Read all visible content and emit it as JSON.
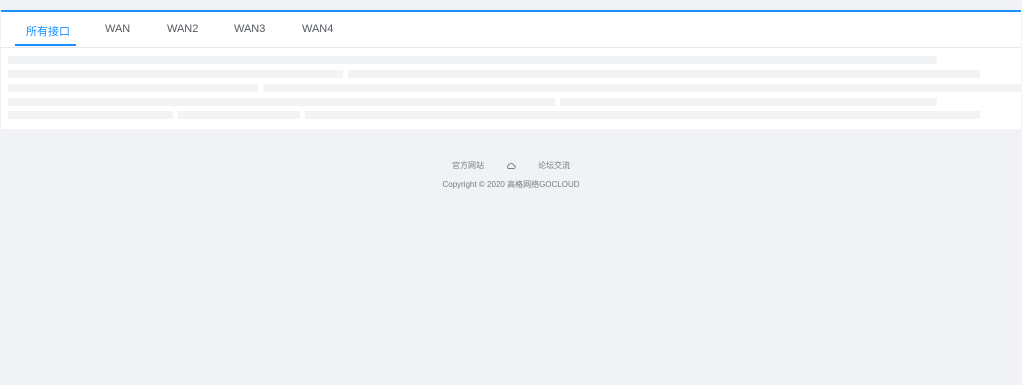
{
  "tabs": [
    {
      "label": "所有接口",
      "active": true
    },
    {
      "label": "WAN",
      "active": false
    },
    {
      "label": "WAN2",
      "active": false
    },
    {
      "label": "WAN3",
      "active": false
    },
    {
      "label": "WAN4",
      "active": false
    }
  ],
  "footer": {
    "official_site": "官方网站",
    "forum": "论坛交流",
    "copyright": "Copyright © 2020 高格网络GOCLOUD",
    "divider_icon": "cloud-icon"
  },
  "colors": {
    "accent": "#1890ff",
    "background": "#f0f2f5",
    "skeleton": "#f2f3f4"
  }
}
